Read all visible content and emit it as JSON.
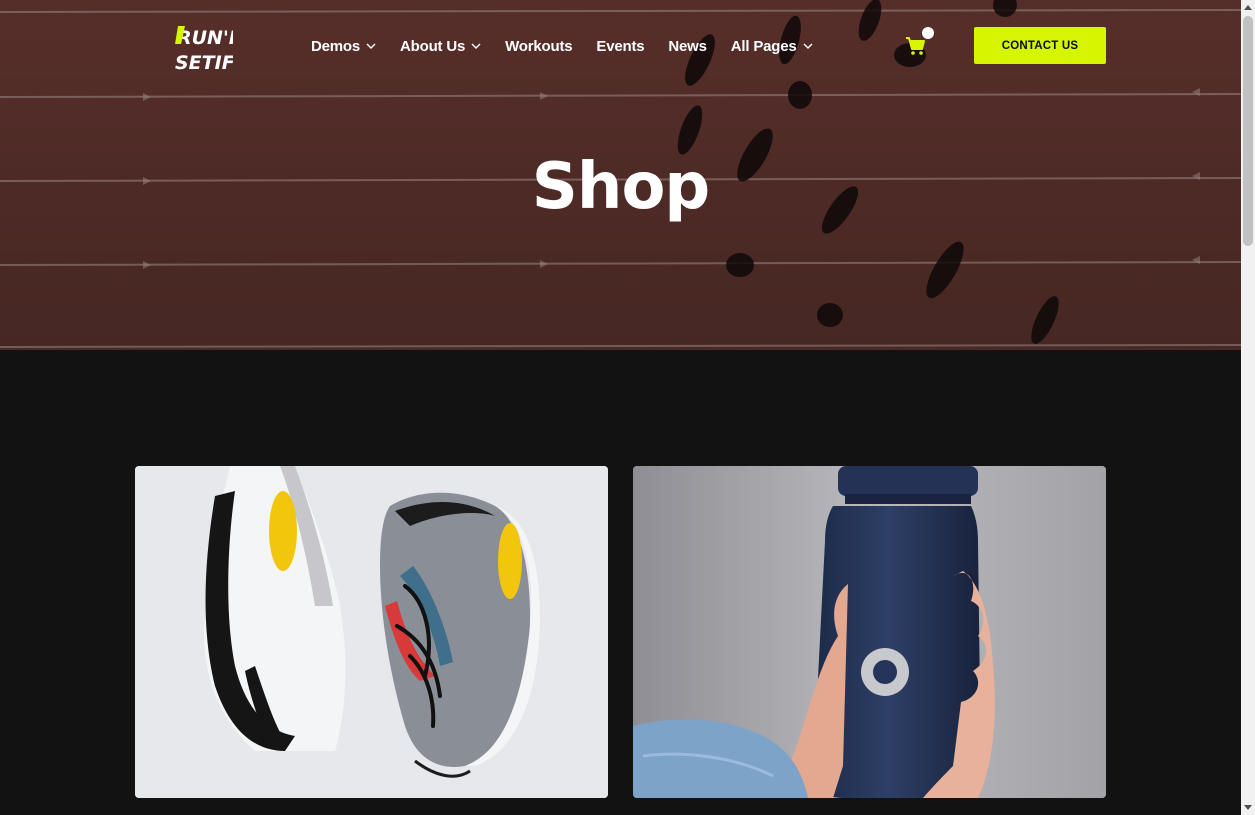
{
  "header": {
    "logo_text": "RUN'IN SETIF",
    "nav": [
      {
        "label": "Demos",
        "has_dropdown": true
      },
      {
        "label": "About Us",
        "has_dropdown": true
      },
      {
        "label": "Workouts",
        "has_dropdown": false
      },
      {
        "label": "Events",
        "has_dropdown": false
      },
      {
        "label": "News",
        "has_dropdown": false
      },
      {
        "label": "All Pages",
        "has_dropdown": true
      }
    ],
    "cart_icon": "shopping-cart-icon",
    "contact_label": "CONTACT US"
  },
  "hero": {
    "title": "Shop"
  },
  "products": [
    {
      "image": "running-sneakers-photo"
    },
    {
      "image": "water-bottle-photo"
    }
  ],
  "colors": {
    "accent": "#d6f500",
    "hero_track": "#6b3a34",
    "background": "#121212"
  }
}
